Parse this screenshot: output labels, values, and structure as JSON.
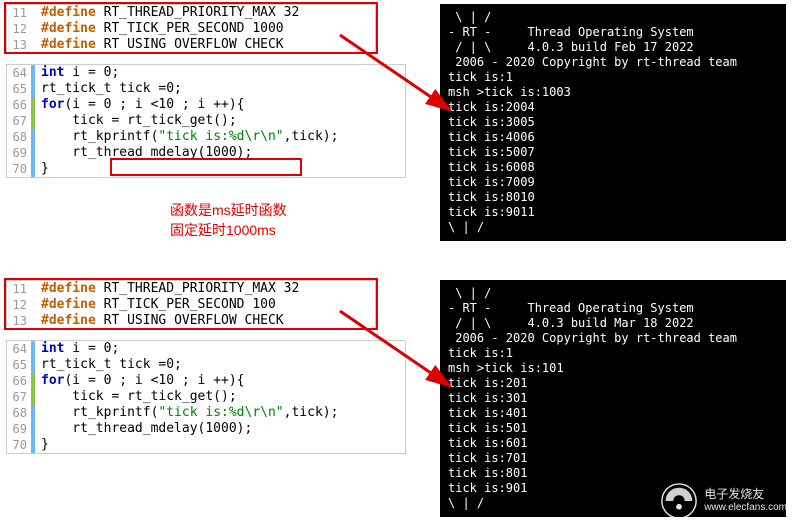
{
  "top_defines": {
    "lines": [
      {
        "n": "11",
        "bar": "",
        "pre": "#define",
        "txt": " RT_THREAD_PRIORITY_MAX 32"
      },
      {
        "n": "12",
        "bar": "",
        "pre": "#define",
        "txt": " RT_TICK_PER_SECOND 1000"
      },
      {
        "n": "13",
        "bar": "",
        "pre": "#define",
        "txt": " RT USING OVERFLOW CHECK"
      }
    ]
  },
  "top_code": {
    "lines": [
      {
        "n": "64",
        "bar": "blue",
        "html": "<span class='kw-type'>int</span> i = 0;"
      },
      {
        "n": "65",
        "bar": "blue",
        "html": "rt_tick_t tick =0;"
      },
      {
        "n": "66",
        "bar": "green",
        "html": "<span class='kw-ctrl'>for</span>(i = 0 ; i &lt;10 ; i ++){"
      },
      {
        "n": "67",
        "bar": "green",
        "html": "    tick = rt_tick_get();"
      },
      {
        "n": "68",
        "bar": "blue",
        "html": "    rt_kprintf(<span class='str'>\"tick is:%d\\r\\n\"</span>,tick);"
      },
      {
        "n": "69",
        "bar": "blue",
        "html": "    rt_thread_mdelay(1000);"
      },
      {
        "n": "70",
        "bar": "blue",
        "html": "}"
      }
    ]
  },
  "top_term": [
    " \\ | /",
    "- RT -     Thread Operating System",
    " / | \\     4.0.3 build Feb 17 2022",
    " 2006 - 2020 Copyright by rt-thread team",
    "tick is:1",
    "msh >tick is:1003",
    "tick is:2004",
    "tick is:3005",
    "tick is:4006",
    "tick is:5007",
    "tick is:6008",
    "tick is:7009",
    "tick is:8010",
    "tick is:9011",
    "\\ | /"
  ],
  "annotation_1": "函数是ms延时函数",
  "annotation_2": "固定延时1000ms",
  "bottom_defines": {
    "lines": [
      {
        "n": "11",
        "bar": "",
        "pre": "#define",
        "txt": " RT_THREAD_PRIORITY_MAX 32"
      },
      {
        "n": "12",
        "bar": "",
        "pre": "#define",
        "txt": " RT_TICK_PER_SECOND 100"
      },
      {
        "n": "13",
        "bar": "",
        "pre": "#define",
        "txt": " RT USING OVERFLOW CHECK"
      }
    ]
  },
  "bottom_code": {
    "lines": [
      {
        "n": "64",
        "bar": "blue",
        "html": "<span class='kw-type'>int</span> i = 0;"
      },
      {
        "n": "65",
        "bar": "blue",
        "html": "rt_tick_t tick =0;"
      },
      {
        "n": "66",
        "bar": "green",
        "html": "<span class='kw-ctrl'>for</span>(i = 0 ; i &lt;10 ; i ++){"
      },
      {
        "n": "67",
        "bar": "green",
        "html": "    tick = rt_tick_get();"
      },
      {
        "n": "68",
        "bar": "blue",
        "html": "    rt_kprintf(<span class='str'>\"tick is:%d\\r\\n\"</span>,tick);"
      },
      {
        "n": "69",
        "bar": "blue",
        "html": "    rt_thread_mdelay(1000);"
      },
      {
        "n": "70",
        "bar": "blue",
        "html": "}"
      }
    ]
  },
  "bottom_term": [
    " \\ | /",
    "- RT -     Thread Operating System",
    " / | \\     4.0.3 build Mar 18 2022",
    " 2006 - 2020 Copyright by rt-thread team",
    "tick is:1",
    "msh >tick is:101",
    "tick is:201",
    "tick is:301",
    "tick is:401",
    "tick is:501",
    "tick is:601",
    "tick is:701",
    "tick is:801",
    "tick is:901",
    "\\ | /"
  ],
  "watermark_title": "电子发烧友",
  "watermark_url": "www.elecfans.com"
}
